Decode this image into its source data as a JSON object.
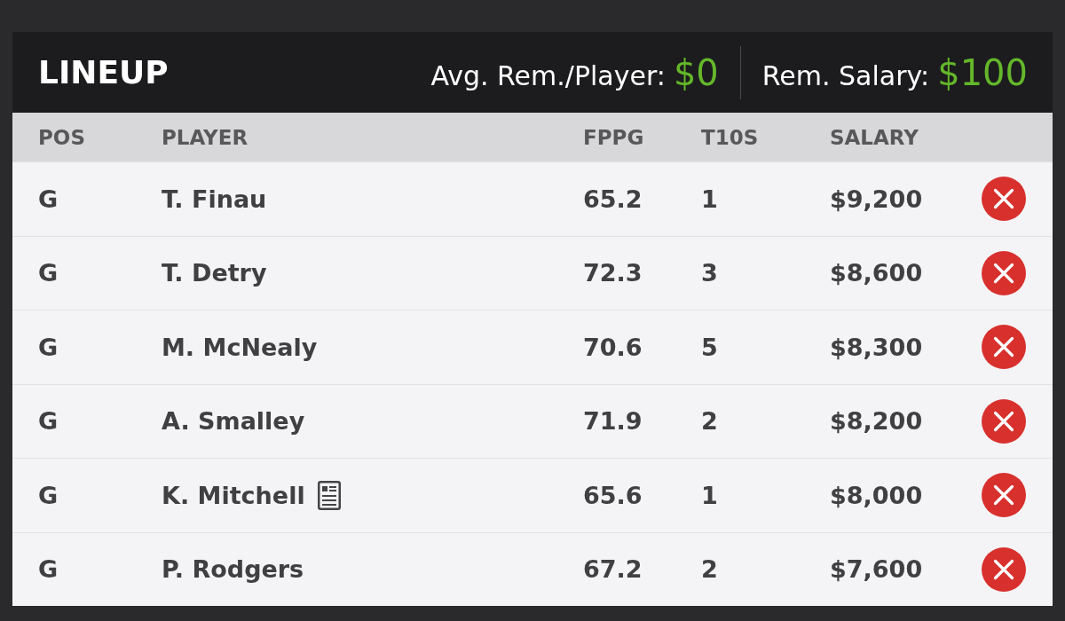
{
  "header": {
    "title": "LINEUP",
    "stats": [
      {
        "label": "Avg. Rem./Player:",
        "value": "$0"
      },
      {
        "label": "Rem. Salary:",
        "value": "$100"
      }
    ]
  },
  "table": {
    "columns": [
      "POS",
      "PLAYER",
      "FPPG",
      "T10S",
      "SALARY"
    ],
    "rows": [
      {
        "pos": "G",
        "player": "T. Finau",
        "news": false,
        "fppg": "65.2",
        "t10s": "1",
        "salary": "$9,200"
      },
      {
        "pos": "G",
        "player": "T. Detry",
        "news": false,
        "fppg": "72.3",
        "t10s": "3",
        "salary": "$8,600"
      },
      {
        "pos": "G",
        "player": "M. McNealy",
        "news": false,
        "fppg": "70.6",
        "t10s": "5",
        "salary": "$8,300"
      },
      {
        "pos": "G",
        "player": "A. Smalley",
        "news": false,
        "fppg": "71.9",
        "t10s": "2",
        "salary": "$8,200"
      },
      {
        "pos": "G",
        "player": "K. Mitchell",
        "news": true,
        "fppg": "65.6",
        "t10s": "1",
        "salary": "$8,000"
      },
      {
        "pos": "G",
        "player": "P. Rodgers",
        "news": false,
        "fppg": "67.2",
        "t10s": "2",
        "salary": "$7,600"
      }
    ]
  }
}
